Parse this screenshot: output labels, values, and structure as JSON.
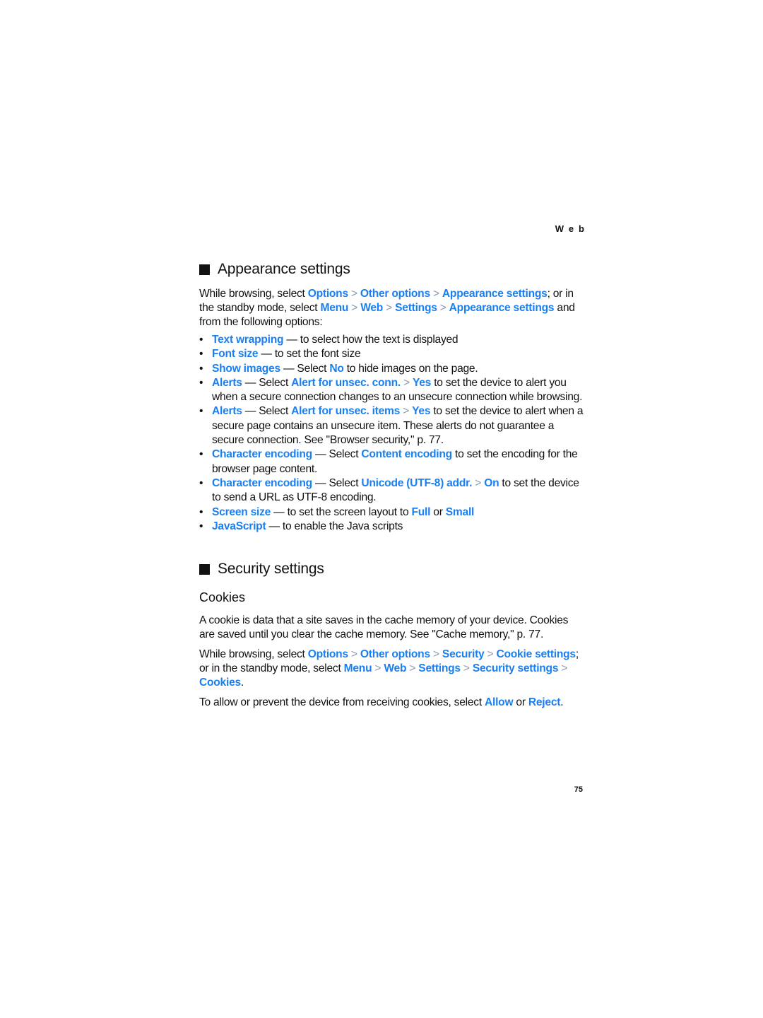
{
  "running_head": "Web",
  "page_number": "75",
  "appearance": {
    "title": "Appearance settings",
    "intro": [
      {
        "t": "While browsing, select "
      },
      {
        "l": "Options"
      },
      {
        "s": " > "
      },
      {
        "l": "Other options"
      },
      {
        "s": " > "
      },
      {
        "l": "Appearance settings"
      },
      {
        "t": "; or in the standby mode, select "
      },
      {
        "l": "Menu"
      },
      {
        "s": " > "
      },
      {
        "l": "Web"
      },
      {
        "s": " > "
      },
      {
        "l": "Settings"
      },
      {
        "s": " > "
      },
      {
        "l": "Appearance settings"
      },
      {
        "t": " and from the following options:"
      }
    ],
    "options": [
      [
        {
          "l": "Text wrapping"
        },
        {
          "t": " — to select how the text is displayed"
        }
      ],
      [
        {
          "l": "Font size"
        },
        {
          "t": " — to set the font size"
        }
      ],
      [
        {
          "l": "Show images"
        },
        {
          "t": " — Select "
        },
        {
          "l": "No"
        },
        {
          "t": " to hide images on the page."
        }
      ],
      [
        {
          "l": "Alerts"
        },
        {
          "t": " — Select "
        },
        {
          "l": "Alert for unsec. conn."
        },
        {
          "s": " > "
        },
        {
          "l": "Yes"
        },
        {
          "t": " to set the device to alert you when a secure connection changes to an unsecure connection while browsing."
        }
      ],
      [
        {
          "l": "Alerts"
        },
        {
          "t": " — Select "
        },
        {
          "l": "Alert for unsec. items"
        },
        {
          "s": " > "
        },
        {
          "l": "Yes"
        },
        {
          "t": " to set the device to alert when a secure page contains an unsecure item. These alerts do not guarantee a secure connection. See \"Browser security,\" p. 77."
        }
      ],
      [
        {
          "l": "Character encoding"
        },
        {
          "t": " — Select "
        },
        {
          "l": "Content encoding"
        },
        {
          "t": " to set the encoding for the browser page content."
        }
      ],
      [
        {
          "l": "Character encoding"
        },
        {
          "t": " — Select "
        },
        {
          "l": "Unicode (UTF-8) addr."
        },
        {
          "s": " > "
        },
        {
          "l": "On"
        },
        {
          "t": " to set the device to send a URL as UTF-8 encoding."
        }
      ],
      [
        {
          "l": "Screen size"
        },
        {
          "t": " — to set the screen layout to "
        },
        {
          "l": "Full"
        },
        {
          "t": " or "
        },
        {
          "l": "Small"
        }
      ],
      [
        {
          "l": "JavaScript"
        },
        {
          "t": " — to enable the Java scripts"
        }
      ]
    ]
  },
  "security": {
    "title": "Security settings",
    "cookies_heading": "Cookies",
    "para1": [
      {
        "t": "A cookie is data that a site saves in the cache memory of your device. Cookies are saved until you clear the cache memory. See \"Cache memory,\" p. 77."
      }
    ],
    "para2": [
      {
        "t": "While browsing, select "
      },
      {
        "l": "Options"
      },
      {
        "s": " > "
      },
      {
        "l": "Other options"
      },
      {
        "s": " > "
      },
      {
        "l": "Security"
      },
      {
        "s": " > "
      },
      {
        "l": "Cookie settings"
      },
      {
        "t": "; or in the standby mode, select "
      },
      {
        "l": "Menu"
      },
      {
        "s": " > "
      },
      {
        "l": "Web"
      },
      {
        "s": " > "
      },
      {
        "l": "Settings"
      },
      {
        "s": " > "
      },
      {
        "l": "Security settings"
      },
      {
        "s": " > "
      },
      {
        "l": "Cookies"
      },
      {
        "t": "."
      }
    ],
    "para3": [
      {
        "t": "To allow or prevent the device from receiving cookies, select "
      },
      {
        "l": "Allow"
      },
      {
        "t": " or "
      },
      {
        "l": "Reject"
      },
      {
        "t": "."
      }
    ]
  }
}
